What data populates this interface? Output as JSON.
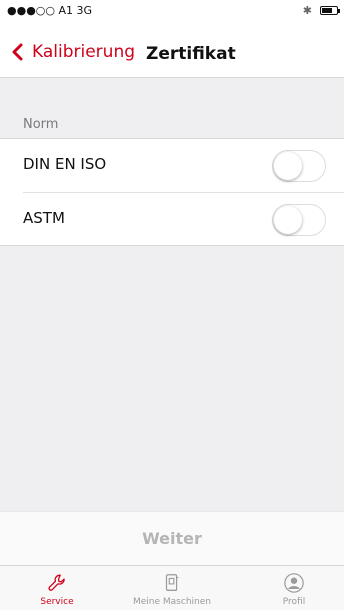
{
  "status_bar": {
    "carrier": "●●●○○ A1  3G",
    "battery_level": 0.7
  },
  "nav": {
    "back_label": "Kalibrierung",
    "title": "Zertifikat"
  },
  "section": {
    "header": "Norm"
  },
  "options": [
    {
      "label": "DIN EN ISO",
      "enabled": false
    },
    {
      "label": "ASTM",
      "enabled": false
    }
  ],
  "footer": {
    "button_label": "Weiter"
  },
  "tab_bar": {
    "tabs": [
      {
        "label": "Service",
        "icon": "wrench-icon",
        "active": true
      },
      {
        "label": "Meine Maschinen",
        "icon": "machine-icon",
        "active": false
      },
      {
        "label": "Profil",
        "icon": "profile-icon",
        "active": false
      }
    ]
  },
  "colors": {
    "accent": "#d0021b",
    "background": "#efeff2",
    "inactive_text": "#9a9a9a"
  }
}
